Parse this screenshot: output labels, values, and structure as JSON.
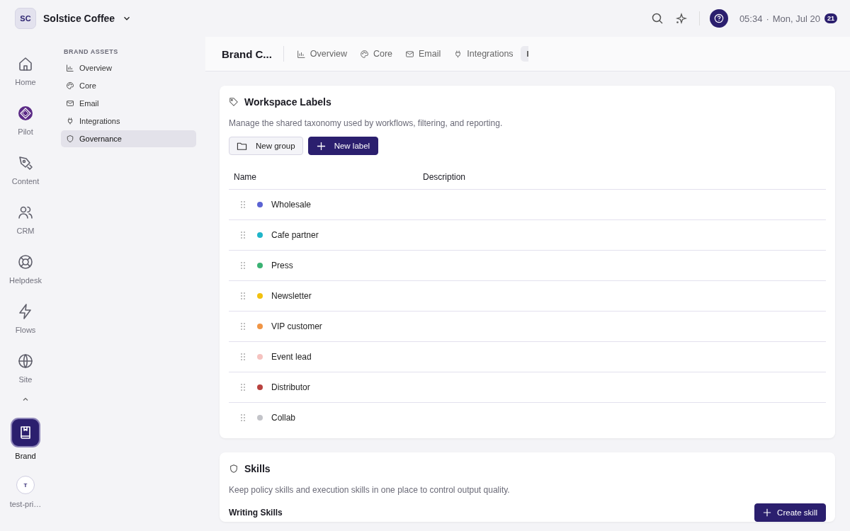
{
  "workspace": {
    "initials": "SC",
    "name": "Solstice Coffee"
  },
  "topbar": {
    "time": "05:34",
    "separator": "·",
    "date": "Mon, Jul 20",
    "badge": "21"
  },
  "rail": [
    {
      "label": "Home",
      "selected": false
    },
    {
      "label": "Pilot",
      "selected": false
    },
    {
      "label": "Content",
      "selected": false
    },
    {
      "label": "CRM",
      "selected": false
    },
    {
      "label": "Helpdesk",
      "selected": false
    },
    {
      "label": "Flows",
      "selected": false
    },
    {
      "label": "Site",
      "selected": false
    },
    {
      "label": "Brand",
      "selected": true
    }
  ],
  "user": {
    "initial": "T",
    "name": "test-pri…"
  },
  "subnav": {
    "heading": "BRAND ASSETS",
    "items": [
      {
        "label": "Overview",
        "selected": false
      },
      {
        "label": "Core",
        "selected": false
      },
      {
        "label": "Email",
        "selected": false
      },
      {
        "label": "Integrations",
        "selected": false
      },
      {
        "label": "Governance",
        "selected": true
      }
    ]
  },
  "page": {
    "title": "Brand C...",
    "tabs": [
      {
        "label": "Overview",
        "selected": false
      },
      {
        "label": "Core",
        "selected": false
      },
      {
        "label": "Email",
        "selected": false
      },
      {
        "label": "Integrations",
        "selected": false
      },
      {
        "selected": true
      }
    ]
  },
  "labels_card": {
    "title": "Workspace Labels",
    "description": "Manage the shared taxonomy used by workflows, filtering, and reporting.",
    "buttons": [
      {
        "label": "New group",
        "kind": "secondary"
      },
      {
        "label": "New label",
        "kind": "primary"
      }
    ],
    "columns": [
      "Name",
      "Description"
    ],
    "rows": [
      {
        "name": "Wholesale",
        "color": "#5b63d3"
      },
      {
        "name": "Cafe partner",
        "color": "#1fb5c9"
      },
      {
        "name": "Press",
        "color": "#3bb273"
      },
      {
        "name": "Newsletter",
        "color": "#f2c10f"
      },
      {
        "name": "VIP customer",
        "color": "#f09545"
      },
      {
        "name": "Event lead",
        "color": "#f5c3c0"
      },
      {
        "name": "Distributor",
        "color": "#b8423f"
      },
      {
        "name": "Collab",
        "color": "#c3c4c9"
      }
    ]
  },
  "skills_card": {
    "title": "Skills",
    "description": "Keep policy skills and execution skills in one place to control output quality.",
    "section": "Writing Skills",
    "button": "Create skill"
  }
}
